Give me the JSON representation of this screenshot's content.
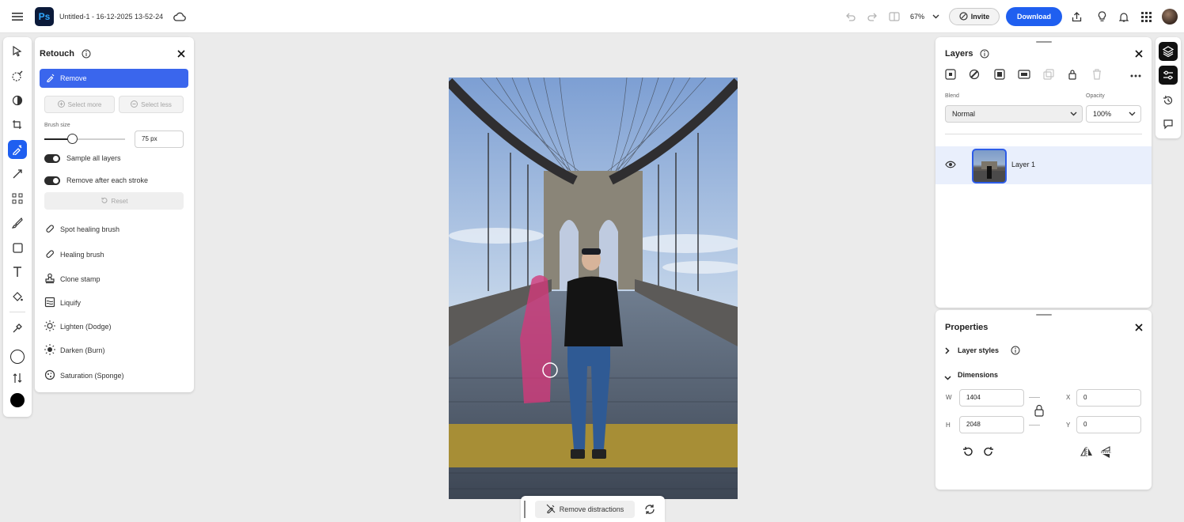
{
  "app": {
    "logo_text": "Ps",
    "document_title": "Untitled-1 - 16-12-2025 13-52-24",
    "zoom_level": "67%",
    "invite_label": "Invite",
    "download_label": "Download"
  },
  "retouch_panel": {
    "title": "Retouch",
    "active_mode": "Remove",
    "select_more_label": "Select more",
    "select_less_label": "Select less",
    "brush_size_label": "Brush size",
    "brush_size_value": "75 px",
    "brush_size_fraction": 0.35,
    "sample_all_layers_label": "Sample all layers",
    "sample_all_layers_on": true,
    "remove_after_stroke_label": "Remove after each stroke",
    "remove_after_stroke_on": true,
    "reset_label": "Reset",
    "tools": [
      {
        "label": "Spot healing brush",
        "icon": "bandage-icon"
      },
      {
        "label": "Healing brush",
        "icon": "bandage-icon"
      },
      {
        "label": "Clone stamp",
        "icon": "stamp-icon"
      },
      {
        "label": "Liquify",
        "icon": "liquify-icon"
      },
      {
        "label": "Lighten (Dodge)",
        "icon": "sun-icon"
      },
      {
        "label": "Darken (Burn)",
        "icon": "sun-dark-icon"
      },
      {
        "label": "Saturation (Sponge)",
        "icon": "sponge-icon"
      }
    ]
  },
  "canvas": {
    "remove_distractions_label": "Remove distractions"
  },
  "layers_panel": {
    "title": "Layers",
    "blend_label": "Blend",
    "blend_value": "Normal",
    "opacity_label": "Opacity",
    "opacity_value": "100%",
    "layers": [
      {
        "name": "Layer 1",
        "visible": true,
        "selected": true
      }
    ]
  },
  "properties_panel": {
    "title": "Properties",
    "layer_styles_label": "Layer styles",
    "dimensions_label": "Dimensions",
    "w_label": "W",
    "h_label": "H",
    "x_label": "X",
    "y_label": "Y",
    "width_value": "1404",
    "height_value": "2048",
    "x_value": "0",
    "y_value": "0"
  },
  "colors": {
    "accent": "#1f5ff0",
    "panel_bg": "#ffffff",
    "workspace_bg": "#ebebeb",
    "selected_row": "#e9effc",
    "removal_mask": "#d2397a"
  }
}
